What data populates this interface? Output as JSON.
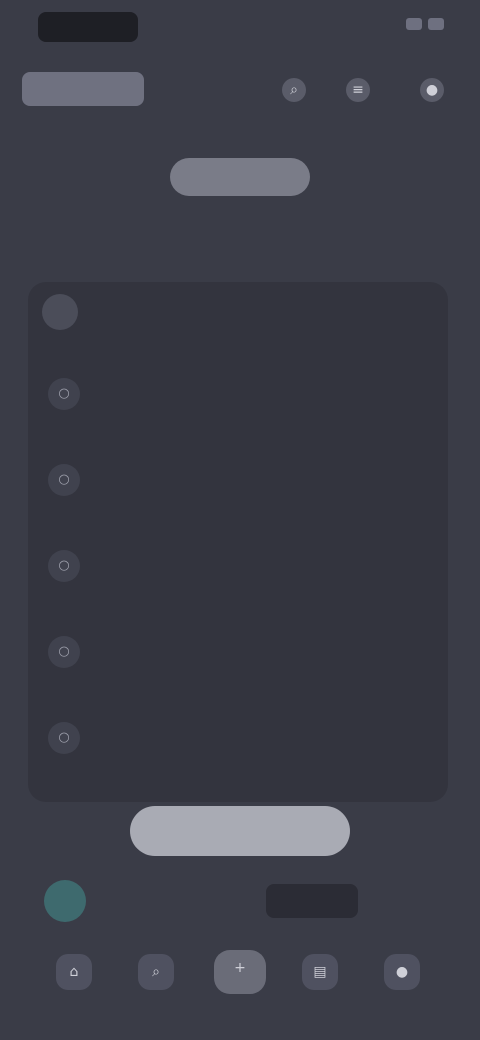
{
  "status_bar": {
    "time": "",
    "icons": [
      "wifi-icon",
      "battery-icon"
    ]
  },
  "header": {
    "title": "",
    "icons": [
      "search-icon",
      "filter-icon",
      "profile-icon"
    ]
  },
  "tabs": [
    {
      "label": ""
    },
    {
      "label": "",
      "active": true
    },
    {
      "label": ""
    }
  ],
  "section": {
    "label": ""
  },
  "list": {
    "header": {
      "text": ""
    },
    "rows": [
      {
        "text": ""
      },
      {
        "text": ""
      },
      {
        "text": ""
      },
      {
        "text": ""
      },
      {
        "text": ""
      }
    ]
  },
  "primary_button": {
    "label": ""
  },
  "mini_player": {
    "text": "",
    "action": ""
  },
  "bottom_nav": {
    "items": [
      {
        "icon": "home-icon"
      },
      {
        "icon": "search-icon"
      },
      {
        "icon": "add-icon"
      },
      {
        "icon": "library-icon"
      },
      {
        "icon": "account-icon"
      }
    ]
  },
  "colors": {
    "background": "#3a3c47",
    "card": "#33343e",
    "accent_button": "#a9abb4",
    "active_tab": "#7a7c88"
  }
}
